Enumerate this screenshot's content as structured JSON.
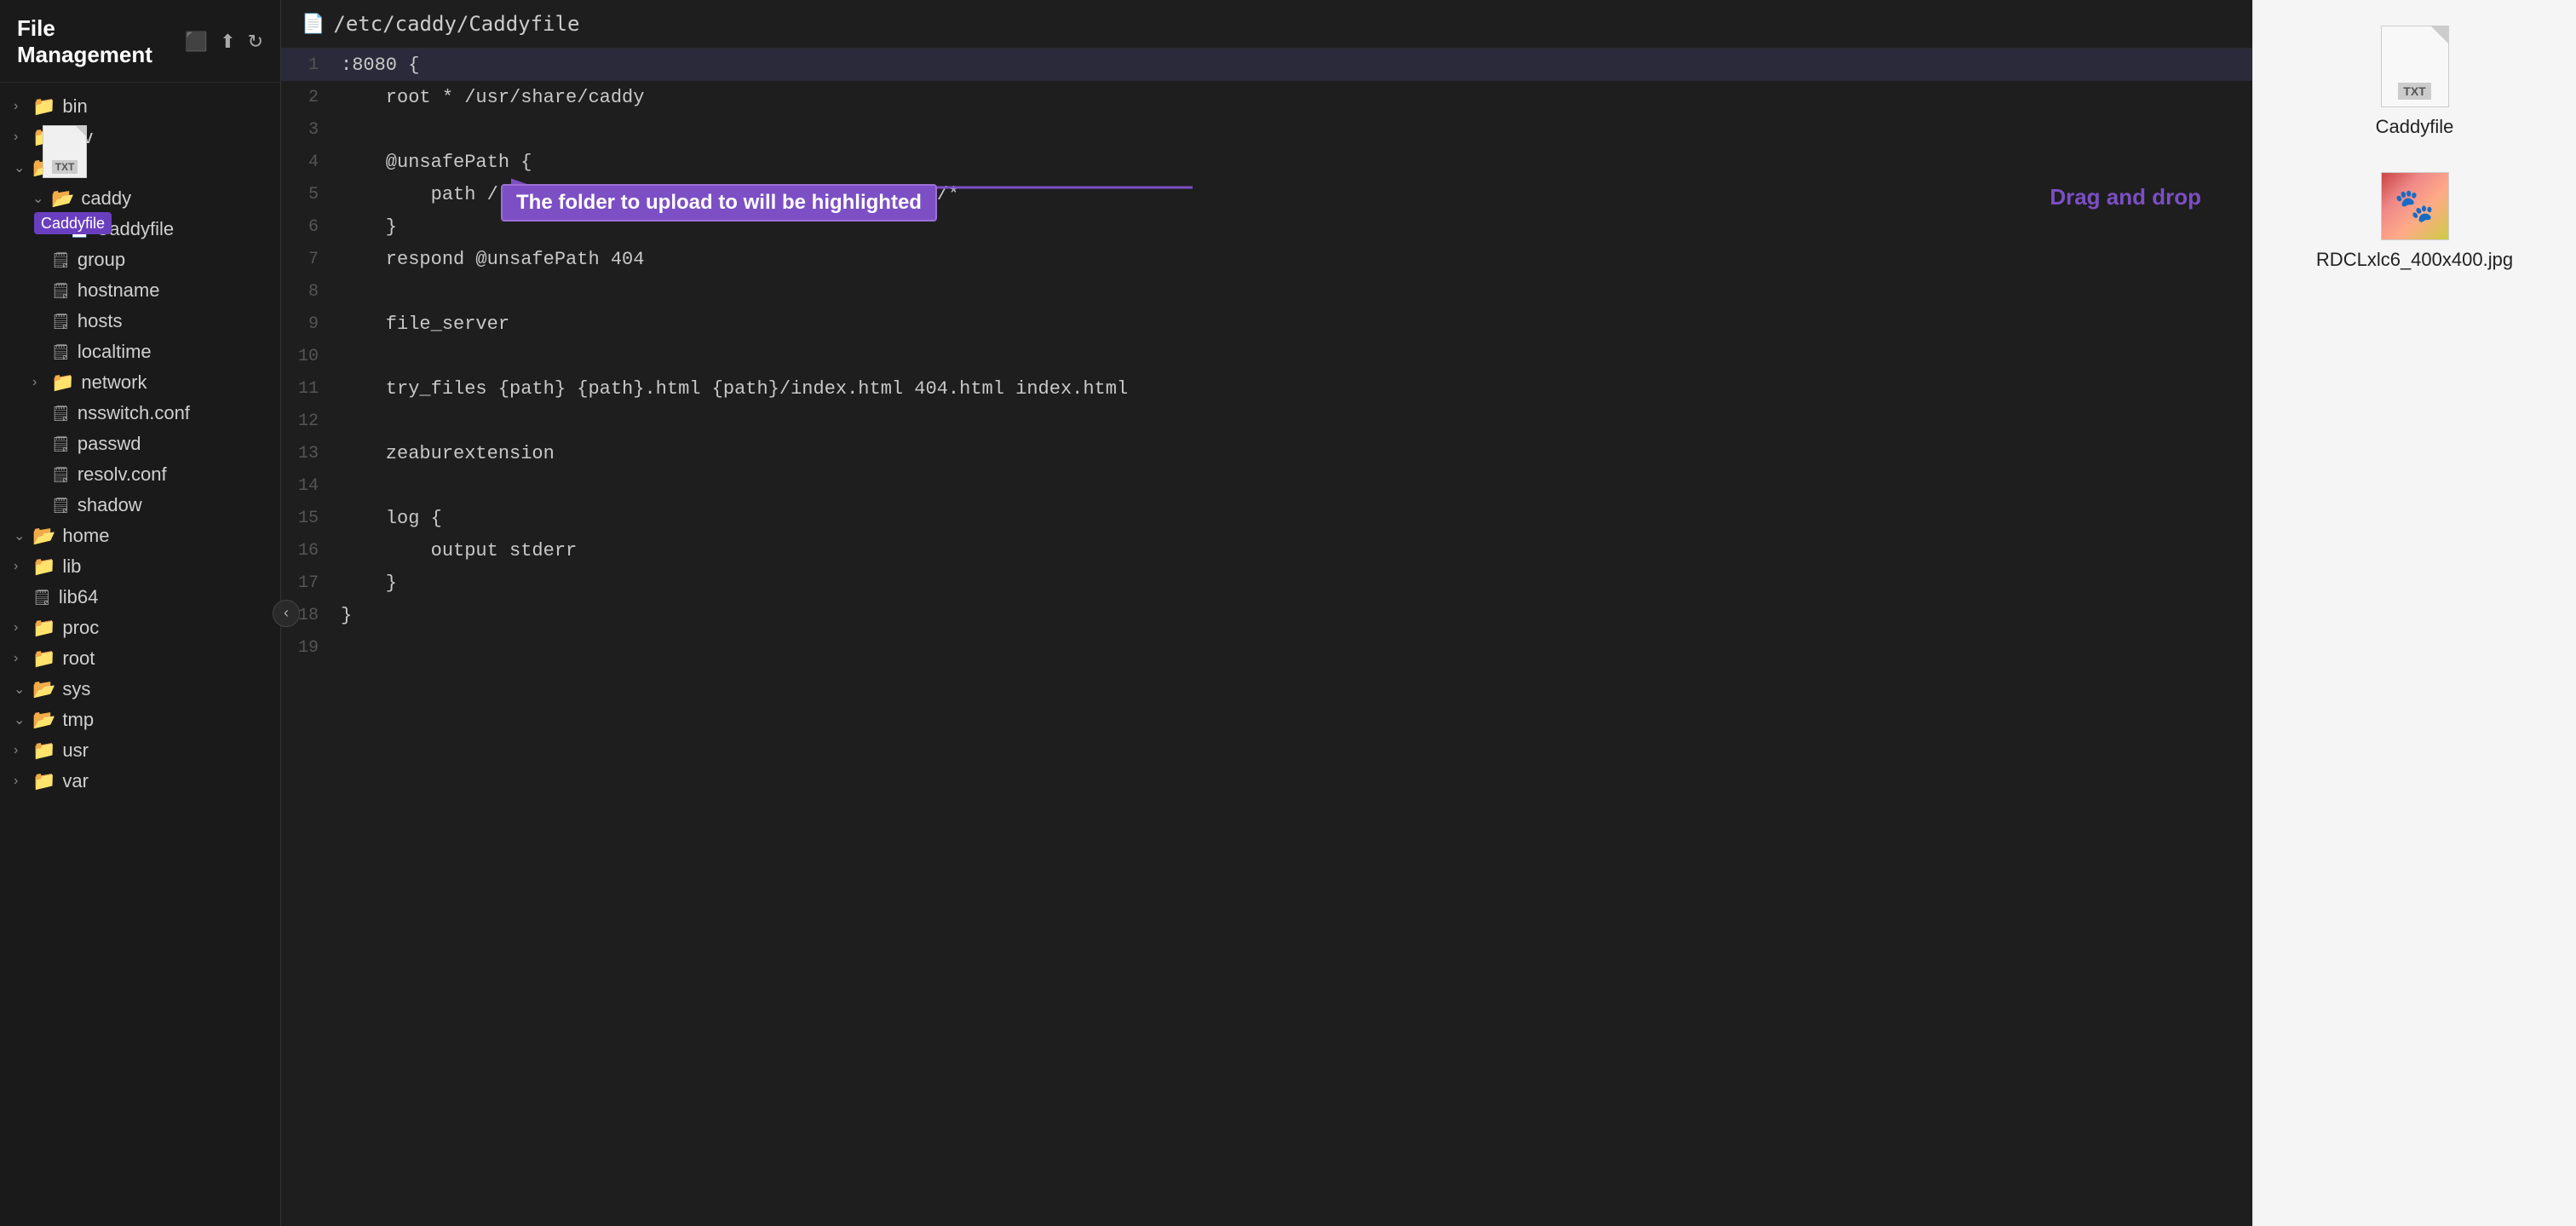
{
  "sidebar": {
    "title": "File Management",
    "header_icons": [
      "video-icon",
      "upload-icon",
      "refresh-icon"
    ],
    "tree": [
      {
        "id": "bin",
        "type": "folder",
        "label": "bin",
        "indent": 0,
        "collapsed": true
      },
      {
        "id": "dev",
        "type": "folder",
        "label": "dev",
        "indent": 0,
        "collapsed": true
      },
      {
        "id": "etc",
        "type": "folder",
        "label": "etc",
        "indent": 0,
        "collapsed": false
      },
      {
        "id": "caddy-folder",
        "type": "folder",
        "label": "caddy",
        "indent": 1,
        "collapsed": false,
        "highlighted": true
      },
      {
        "id": "caddyfile",
        "type": "file",
        "label": "Caddyfile",
        "indent": 2
      },
      {
        "id": "group",
        "type": "file-plain",
        "label": "group",
        "indent": 1
      },
      {
        "id": "hostname",
        "type": "file-plain",
        "label": "hostname",
        "indent": 1
      },
      {
        "id": "hosts",
        "type": "file-plain",
        "label": "hosts",
        "indent": 1
      },
      {
        "id": "localtime",
        "type": "file-plain",
        "label": "localtime",
        "indent": 1
      },
      {
        "id": "network",
        "type": "folder",
        "label": "network",
        "indent": 1,
        "collapsed": true
      },
      {
        "id": "nsswitch",
        "type": "file-plain",
        "label": "nsswitch.conf",
        "indent": 1
      },
      {
        "id": "passwd",
        "type": "file-plain",
        "label": "passwd",
        "indent": 1
      },
      {
        "id": "resolv",
        "type": "file-plain",
        "label": "resolv.conf",
        "indent": 1
      },
      {
        "id": "shadow",
        "type": "file-plain",
        "label": "shadow",
        "indent": 1
      },
      {
        "id": "home",
        "type": "folder",
        "label": "home",
        "indent": 0,
        "collapsed": false
      },
      {
        "id": "lib",
        "type": "folder",
        "label": "lib",
        "indent": 0,
        "collapsed": true
      },
      {
        "id": "lib64",
        "type": "file-plain",
        "label": "lib64",
        "indent": 0
      },
      {
        "id": "proc",
        "type": "folder",
        "label": "proc",
        "indent": 0,
        "collapsed": true
      },
      {
        "id": "root",
        "type": "folder",
        "label": "root",
        "indent": 0,
        "collapsed": true
      },
      {
        "id": "sys",
        "type": "folder",
        "label": "sys",
        "indent": 0,
        "collapsed": false
      },
      {
        "id": "tmp",
        "type": "folder",
        "label": "tmp",
        "indent": 0,
        "collapsed": false
      },
      {
        "id": "usr",
        "type": "folder",
        "label": "usr",
        "indent": 0,
        "collapsed": true
      },
      {
        "id": "var",
        "type": "folder",
        "label": "var",
        "indent": 0,
        "collapsed": true
      }
    ]
  },
  "file_header": {
    "path": "/etc/caddy/Caddyfile",
    "icon": "📄"
  },
  "code": {
    "lines": [
      {
        "num": 1,
        "text": ":8080 {",
        "highlighted": true
      },
      {
        "num": 2,
        "text": "    root * /usr/share/caddy"
      },
      {
        "num": 3,
        "text": ""
      },
      {
        "num": 4,
        "text": "    @unsafePath {"
      },
      {
        "num": 5,
        "text": "        path /.git/* /node_modules/* /vendor/* /.venv/*"
      },
      {
        "num": 6,
        "text": "    }"
      },
      {
        "num": 7,
        "text": "    respond @unsafePath 404"
      },
      {
        "num": 8,
        "text": ""
      },
      {
        "num": 9,
        "text": "    file_server"
      },
      {
        "num": 10,
        "text": ""
      },
      {
        "num": 11,
        "text": "    try_files {path} {path}.html {path}/index.html 404.html index.html"
      },
      {
        "num": 12,
        "text": ""
      },
      {
        "num": 13,
        "text": "    zeaburextension"
      },
      {
        "num": 14,
        "text": ""
      },
      {
        "num": 15,
        "text": "    log {"
      },
      {
        "num": 16,
        "text": "        output stderr"
      },
      {
        "num": 17,
        "text": "    }"
      },
      {
        "num": 18,
        "text": "}"
      },
      {
        "num": 19,
        "text": ""
      }
    ]
  },
  "annotations": {
    "highlight_label": "The folder to upload to will be highlighted",
    "drag_label": "Drag and drop"
  },
  "right_panel": {
    "items": [
      {
        "id": "caddyfile-item",
        "type": "txt",
        "label": "Caddyfile"
      },
      {
        "id": "jpg-item",
        "type": "jpg",
        "label": "RDCLxlc6_400x400.jpg"
      }
    ]
  },
  "caddy_tooltip": "Caddyfile"
}
